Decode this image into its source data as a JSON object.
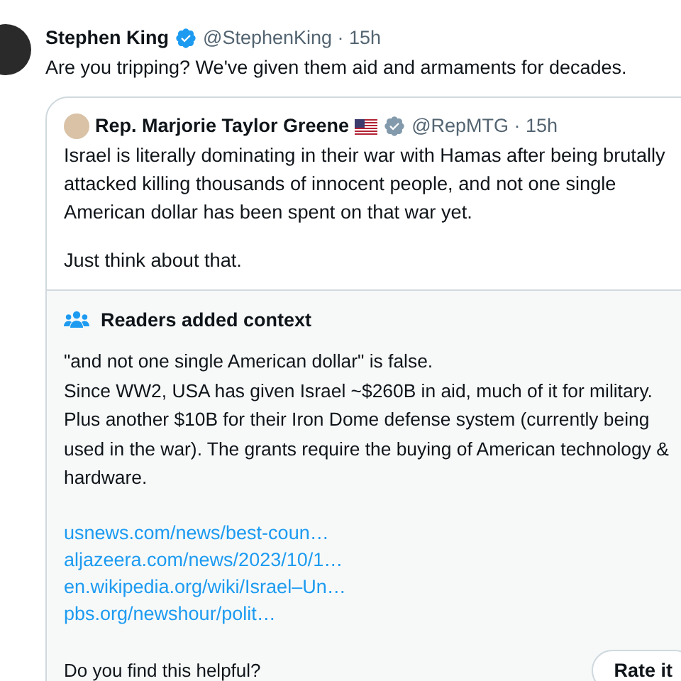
{
  "tweet": {
    "name": "Stephen King",
    "verified": true,
    "color": "#1d9bf0",
    "handle": "@StephenKing · 15h",
    "text": "Are you tripping? We've given them aid and armaments for decades.",
    "quote": {
      "name": "Rep. Marjorie Taylor Greene",
      "verified": true,
      "color": "#829aab",
      "handle": "@RepMTG · 15h",
      "paragraphs": [
        "Israel is literally dominating in their war with Hamas after being brutally attacked killing thousands of innocent people, and not one single American dollar has been spent on that war yet.",
        "Just think about that."
      ]
    },
    "context": {
      "heading": "Readers added context",
      "text": "\"and not one single American dollar\" is false.\nSince WW2, USA has given Israel ~$260B in aid, much of it for military. Plus another $10B for their Iron Dome defense system (currently being used in the war). The grants require the buying of American technology & hardware.",
      "links": [
        "usnews.com/news/best-coun…",
        "aljazeera.com/news/2023/10/1…",
        "en.wikipedia.org/wiki/Israel–Un…",
        "pbs.org/newshour/polit…"
      ],
      "question": "Do you find this helpful?",
      "button": "Rate it"
    }
  }
}
